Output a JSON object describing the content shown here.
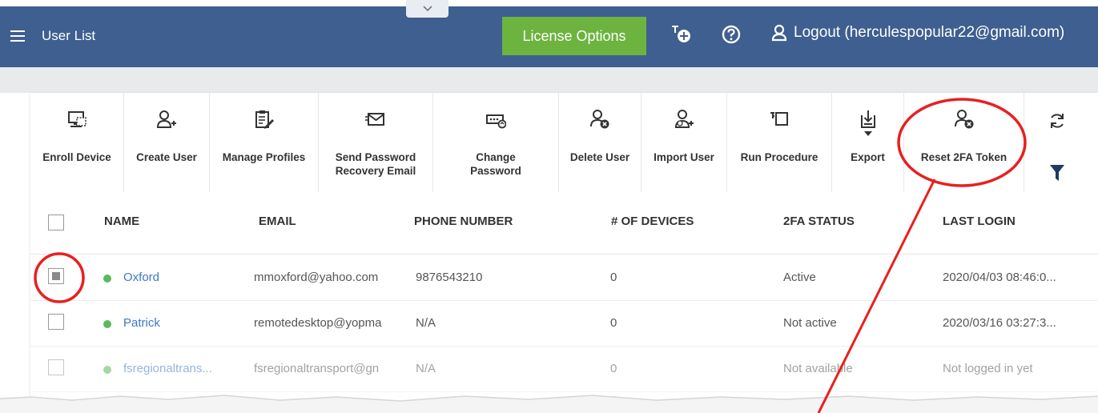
{
  "header": {
    "title": "User List",
    "license_button": "License Options",
    "logout_text": "Logout (herculespopular22@gmail.com)",
    "icons": [
      "menu-icon",
      "chevron-down-icon",
      "add-notification-icon",
      "help-icon",
      "user-icon"
    ],
    "colors": {
      "bar": "#3e5f8f",
      "license": "#6db33f"
    }
  },
  "toolbar": {
    "enroll": "Enroll Device",
    "create": "Create User",
    "manage": "Manage Profiles",
    "send_l1": "Send Password",
    "send_l2": "Recovery Email",
    "change_l1": "Change",
    "change_l2": "Password",
    "delete": "Delete User",
    "import": "Import User",
    "run": "Run Procedure",
    "export": "Export",
    "reset": "Reset 2FA Token"
  },
  "table": {
    "columns": [
      "NAME",
      "EMAIL",
      "PHONE NUMBER",
      "# OF DEVICES",
      "2FA STATUS",
      "LAST LOGIN"
    ],
    "rows": [
      {
        "name": "Oxford",
        "email": "mmoxford@yahoo.com",
        "phone": "9876543210",
        "devices": "0",
        "status": "Active",
        "last_login": "2020/04/03 08:46:0..."
      },
      {
        "name": "Patrick",
        "email": "remotedesktop@yopma",
        "phone": "N/A",
        "devices": "0",
        "status": "Not active",
        "last_login": "2020/03/16 03:27:3..."
      },
      {
        "name": "fsregionaltrans...",
        "email": "fsregionaltransport@gn",
        "phone": "N/A",
        "devices": "0",
        "status": "Not available",
        "last_login": "Not logged in yet"
      }
    ]
  },
  "annotation_color": "#e8201f"
}
